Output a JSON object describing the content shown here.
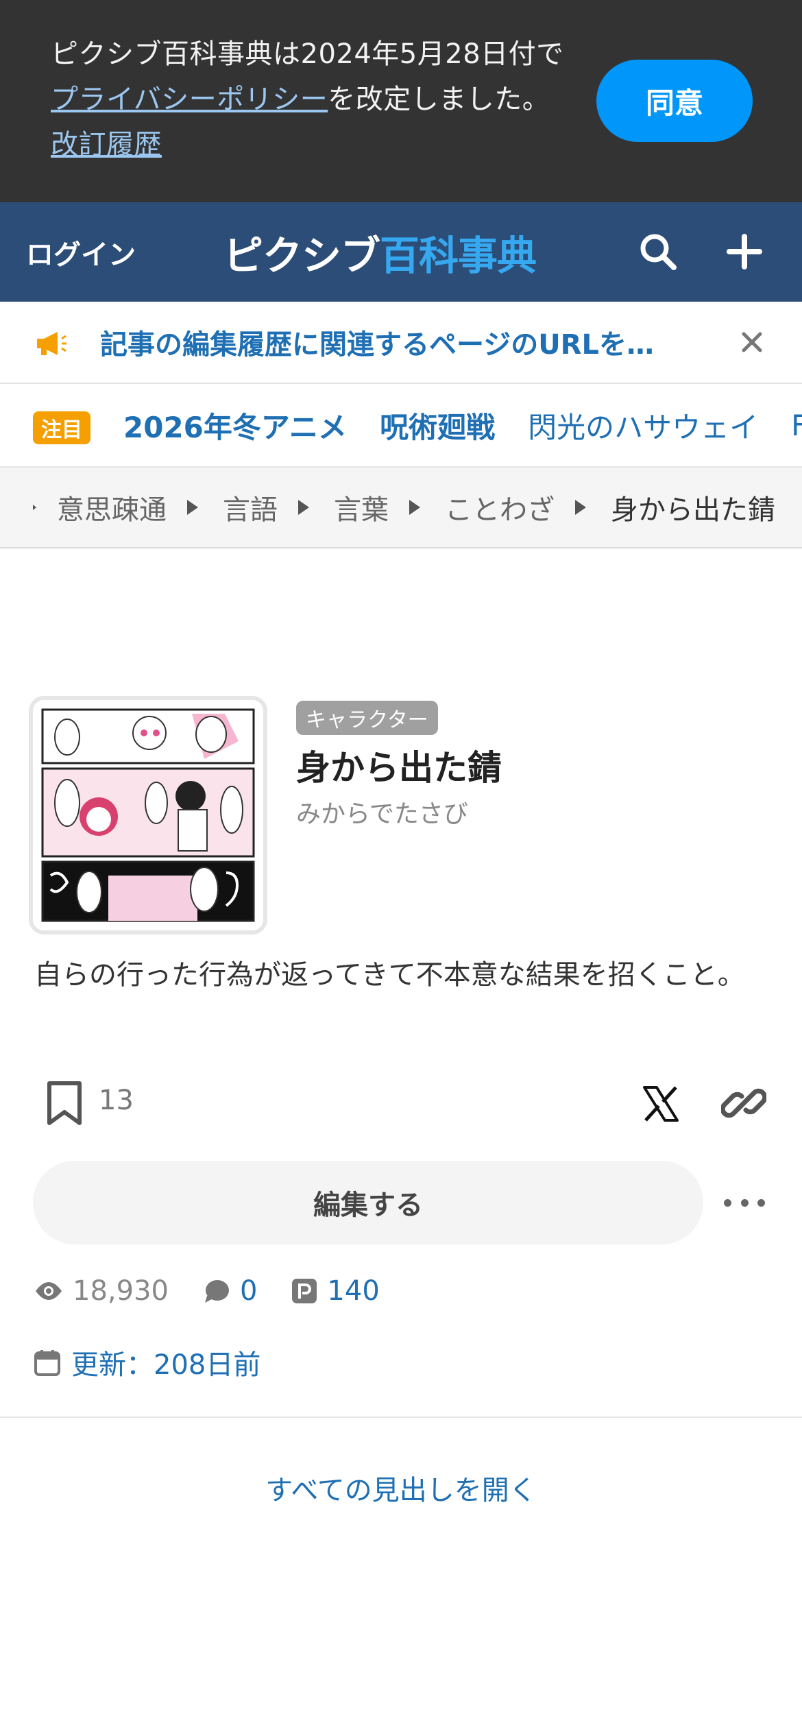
{
  "privacy_banner": {
    "text_before": "ピクシブ百科事典は2024年5月28日付で",
    "link_policy": "プライバシーポリシー",
    "text_after": "を改定しました。",
    "link_history": "改訂履歴",
    "agree_label": "同意"
  },
  "header": {
    "login_label": "ログイン",
    "logo_part1": "ピクシブ",
    "logo_part2": "百科事典",
    "search_icon": "search-icon",
    "plus_icon": "plus-icon"
  },
  "notice": {
    "icon": "megaphone-icon",
    "text": "記事の編集履歴に関連するページのURLを…",
    "close_icon": "close-icon"
  },
  "trending": {
    "badge": "注目",
    "items": [
      {
        "label": "2026年冬アニメ",
        "bold": true
      },
      {
        "label": "呪術廻戦",
        "bold": true
      },
      {
        "label": "閃光のハサウェイ",
        "bold": false
      },
      {
        "label": "F",
        "bold": false
      }
    ]
  },
  "breadcrumb": {
    "items": [
      "意思疎通",
      "言語",
      "言葉",
      "ことわざ"
    ],
    "current": "身から出た錆"
  },
  "article": {
    "category_tag": "キャラクター",
    "title": "身から出た錆",
    "reading": "みからでたさび",
    "summary": "自らの行った行為が返ってきて不本意な結果を招くこと。",
    "bookmark_count": "13",
    "edit_label": "編集する",
    "views": "18,930",
    "comments": "0",
    "pixiv_works": "140",
    "updated": "更新：208日前",
    "open_all_headings": "すべての見出しを開く"
  },
  "colors": {
    "header_bg": "#2c4d77",
    "accent_blue": "#0096fa",
    "link_blue": "#1e6fb3",
    "badge_orange": "#f5a000"
  }
}
